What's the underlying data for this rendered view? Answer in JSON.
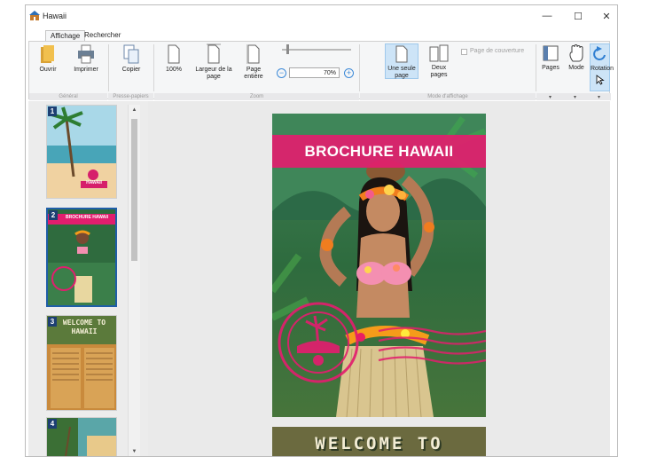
{
  "window": {
    "title": "Hawaii",
    "minimize_glyph": "—",
    "maximize_glyph": "☐",
    "close_glyph": "✕"
  },
  "tabs": [
    {
      "label": "Affichage",
      "active": true
    },
    {
      "label": "Rechercher",
      "active": false
    }
  ],
  "ribbon": {
    "groups": {
      "general": "Général",
      "clipboard": "Presse-papiers",
      "zoom": "Zoom",
      "display_mode": "Mode d'affichage"
    },
    "buttons": {
      "open": "Ouvrir",
      "print": "Imprimer",
      "copy": "Copier",
      "zoom_100": "100%",
      "page_width_line1": "Largeur de la",
      "page_width_line2": "page",
      "full_page_line1": "Page",
      "full_page_line2": "entière",
      "single_page_line1": "Une seule",
      "single_page_line2": "page",
      "two_pages_line1": "Deux",
      "two_pages_line2": "pages",
      "pages": "Pages",
      "mode": "Mode",
      "rotation": "Rotation"
    },
    "zoom_value": "70%",
    "cover_page_label": "Page de couverture",
    "cover_page_checked": false
  },
  "thumbnails": [
    {
      "number": "1",
      "label": "HAWAII",
      "selected": false
    },
    {
      "number": "2",
      "label": "BROCHURE HAWAII",
      "selected": true
    },
    {
      "number": "3",
      "label": "WELCOME TO HAWAII",
      "selected": false
    },
    {
      "number": "4",
      "label": "",
      "selected": false
    }
  ],
  "document": {
    "current_headline": "BROCHURE HAWAII",
    "next_headline": "WELCOME TO"
  },
  "colors": {
    "accent_pink": "#e21e6e",
    "selection_blue": "#1f5ea8",
    "ribbon_bg": "#f5f6f7"
  }
}
